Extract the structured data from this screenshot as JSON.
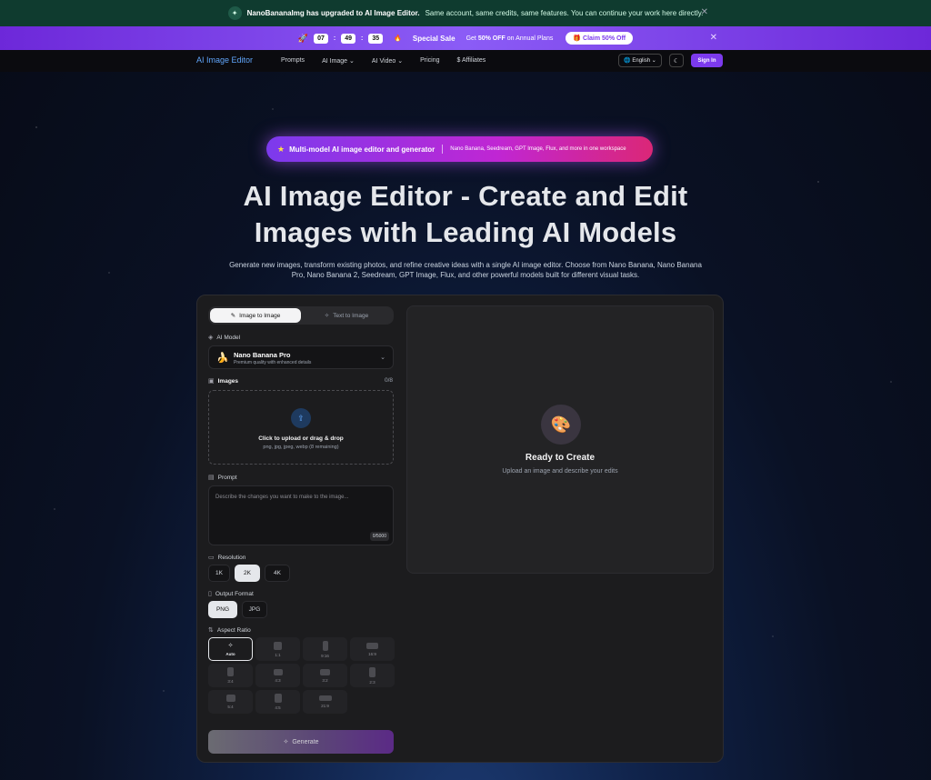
{
  "notice": {
    "icon": "sparkle-icon",
    "brand": "NanoBananaImg has upgraded to AI Image Editor.",
    "text": "Same account, same credits, same features. You can continue your work here directly."
  },
  "promo": {
    "timer": [
      "07",
      "49",
      "35"
    ],
    "sale_label": "Special Sale",
    "offer_prefix": "Get",
    "offer_bold": "50% OFF",
    "offer_suffix": "on Annual Plans",
    "claim_label": "Claim 50% Off"
  },
  "nav": {
    "logo": "AI Image Editor",
    "links": [
      "Prompts",
      "AI Image",
      "AI Video",
      "Pricing",
      "Affiliates"
    ],
    "language": "English",
    "signin": "Sign In"
  },
  "hero": {
    "badge_main": "Multi-model AI image editor and generator",
    "badge_sub": "Nano Banana, Seedream, GPT Image, Flux, and more in one workspace",
    "title_line1": "AI Image Editor - Create and Edit",
    "title_line2": "Images with Leading AI Models",
    "description": "Generate new images, transform existing photos, and refine creative ideas with a single AI image editor. Choose from Nano Banana, Nano Banana Pro, Nano Banana 2, Seedream, GPT Image, Flux, and other powerful models built for different visual tasks."
  },
  "editor": {
    "tabs": [
      "Image to Image",
      "Text to Image"
    ],
    "model_label": "AI Model",
    "model_name": "Nano Banana Pro",
    "model_desc": "Premium quality with enhanced details",
    "images_label": "Images",
    "images_count": "0/8",
    "upload_title": "Click to upload or drag & drop",
    "upload_formats": "png, jpg, jpeg, webp (8 remaining)",
    "prompt_label": "Prompt",
    "prompt_placeholder": "Describe the changes you want to make to the image...",
    "prompt_count": "0/5000",
    "resolution_label": "Resolution",
    "resolutions": [
      "1K",
      "2K",
      "4K"
    ],
    "resolution_selected": "2K",
    "format_label": "Output Format",
    "formats": [
      "PNG",
      "JPG"
    ],
    "format_selected": "PNG",
    "aspect_label": "Aspect Ratio",
    "aspects": [
      "Auto",
      "1:1",
      "9:16",
      "16:9",
      "3:4",
      "4:3",
      "3:2",
      "2:3",
      "5:4",
      "4:5",
      "21:9"
    ],
    "aspect_selected": "Auto",
    "generate_label": "Generate"
  },
  "preview": {
    "title": "Ready to Create",
    "subtitle": "Upload an image and describe your edits"
  }
}
